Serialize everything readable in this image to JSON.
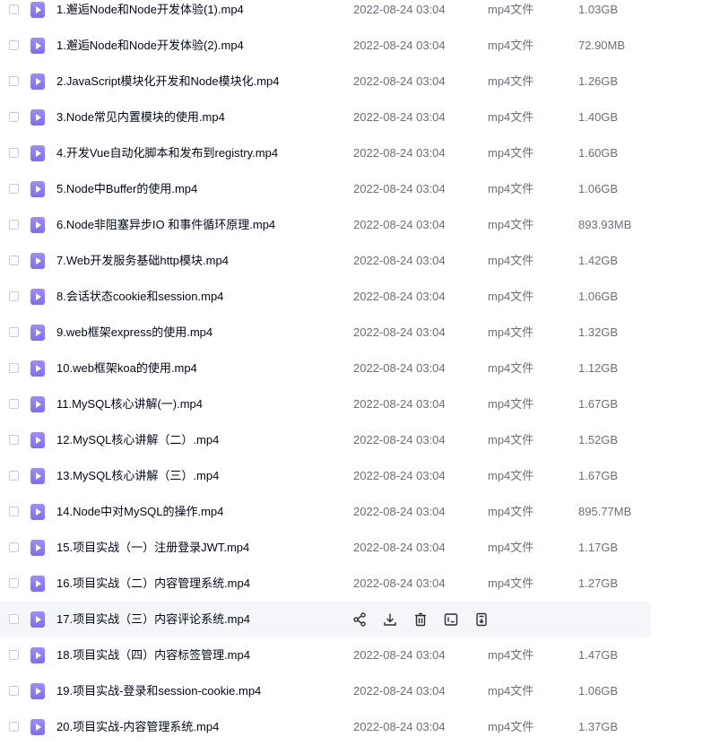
{
  "files": [
    {
      "name": "1.邂逅Node和Node开发体验(1).mp4",
      "date": "2022-08-24 03:04",
      "type": "mp4文件",
      "size": "1.03GB"
    },
    {
      "name": "1.邂逅Node和Node开发体验(2).mp4",
      "date": "2022-08-24 03:04",
      "type": "mp4文件",
      "size": "72.90MB"
    },
    {
      "name": "2.JavaScript模块化开发和Node模块化.mp4",
      "date": "2022-08-24 03:04",
      "type": "mp4文件",
      "size": "1.26GB"
    },
    {
      "name": "3.Node常见内置模块的使用.mp4",
      "date": "2022-08-24 03:04",
      "type": "mp4文件",
      "size": "1.40GB"
    },
    {
      "name": "4.开发Vue自动化脚本和发布到registry.mp4",
      "date": "2022-08-24 03:04",
      "type": "mp4文件",
      "size": "1.60GB"
    },
    {
      "name": "5.Node中Buffer的使用.mp4",
      "date": "2022-08-24 03:04",
      "type": "mp4文件",
      "size": "1.06GB"
    },
    {
      "name": "6.Node非阻塞异步IO 和事件循环原理.mp4",
      "date": "2022-08-24 03:04",
      "type": "mp4文件",
      "size": "893.93MB"
    },
    {
      "name": "7.Web开发服务基础http模块.mp4",
      "date": "2022-08-24 03:04",
      "type": "mp4文件",
      "size": "1.42GB"
    },
    {
      "name": "8.会话状态cookie和session.mp4",
      "date": "2022-08-24 03:04",
      "type": "mp4文件",
      "size": "1.06GB"
    },
    {
      "name": "9.web框架express的使用.mp4",
      "date": "2022-08-24 03:04",
      "type": "mp4文件",
      "size": "1.32GB"
    },
    {
      "name": "10.web框架koa的使用.mp4",
      "date": "2022-08-24 03:04",
      "type": "mp4文件",
      "size": "1.12GB"
    },
    {
      "name": "11.MySQL核心讲解(一).mp4",
      "date": "2022-08-24 03:04",
      "type": "mp4文件",
      "size": "1.67GB"
    },
    {
      "name": "12.MySQL核心讲解（二）.mp4",
      "date": "2022-08-24 03:04",
      "type": "mp4文件",
      "size": "1.52GB"
    },
    {
      "name": "13.MySQL核心讲解（三）.mp4",
      "date": "2022-08-24 03:04",
      "type": "mp4文件",
      "size": "1.67GB"
    },
    {
      "name": "14.Node中对MySQL的操作.mp4",
      "date": "2022-08-24 03:04",
      "type": "mp4文件",
      "size": "895.77MB"
    },
    {
      "name": "15.项目实战（一）注册登录JWT.mp4",
      "date": "2022-08-24 03:04",
      "type": "mp4文件",
      "size": "1.17GB"
    },
    {
      "name": "16.项目实战（二）内容管理系统.mp4",
      "date": "2022-08-24 03:04",
      "type": "mp4文件",
      "size": "1.27GB"
    },
    {
      "name": "17.项目实战（三）内容评论系统.mp4",
      "hovered": true
    },
    {
      "name": "18.项目实战（四）内容标签管理.mp4",
      "date": "2022-08-24 03:04",
      "type": "mp4文件",
      "size": "1.47GB"
    },
    {
      "name": "19.项目实战-登录和session-cookie.mp4",
      "date": "2022-08-24 03:04",
      "type": "mp4文件",
      "size": "1.06GB"
    },
    {
      "name": "20.项目实战-内容管理系统.mp4",
      "date": "2022-08-24 03:04",
      "type": "mp4文件",
      "size": "1.37GB"
    }
  ],
  "row_actions": [
    "share-icon",
    "download-icon",
    "delete-icon",
    "rename-icon",
    "more-icon"
  ],
  "colors": {
    "file_icon": "#8b77f7",
    "hover_bg": "#f5f6f9",
    "text_primary": "#03081a",
    "text_secondary": "#6b6f7a"
  }
}
